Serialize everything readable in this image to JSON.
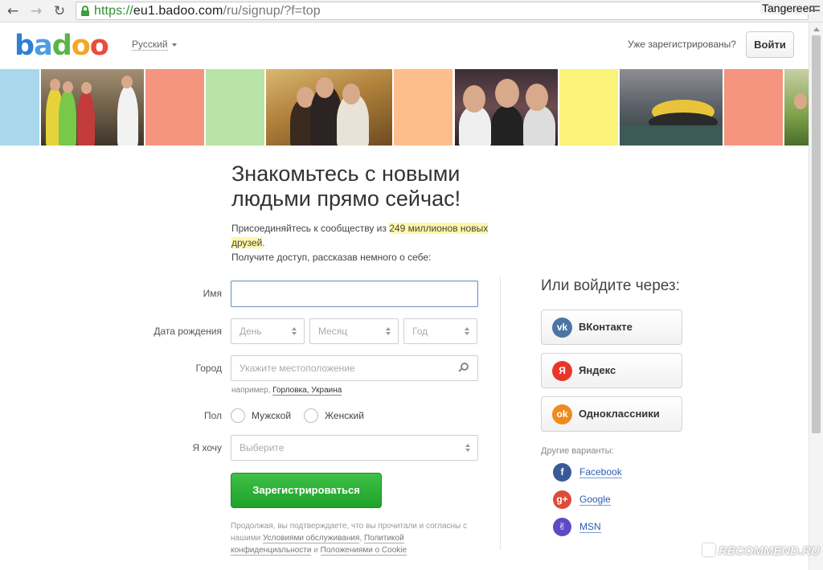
{
  "browser": {
    "url_scheme": "https://",
    "url_host": "eu1.badoo.com",
    "url_path": "/ru/signup/?f=top",
    "profile_name": "Tangereen"
  },
  "header": {
    "logo": [
      "b",
      "a",
      "d",
      "o",
      "o"
    ],
    "language": "Русский",
    "already_registered": "Уже зарегистрированы?",
    "login_label": "Войти"
  },
  "strip": {
    "colors": {
      "blue": "#a9d8ec",
      "coral": "#f5947f",
      "green": "#b8e4a8",
      "peach": "#fdbd8c",
      "yellow": "#fbf27a"
    }
  },
  "hero": {
    "title_line1": "Знакомьтесь с новыми",
    "title_line2": "людьми прямо сейчас!",
    "lead_pre": "Присоединяйтесь к сообществу из ",
    "lead_highlight": "249 миллионов новых друзей",
    "lead_post": ".",
    "lead_line3": "Получите доступ, рассказав немного о себе:"
  },
  "form": {
    "name_label": "Имя",
    "name_value": "",
    "birth_label": "Дата рождения",
    "day_placeholder": "День",
    "month_placeholder": "Месяц",
    "year_placeholder": "Год",
    "city_label": "Город",
    "city_placeholder": "Укажите местоположение",
    "example_prefix": "например, ",
    "example_link": "Горловка, Украина",
    "gender_label": "Пол",
    "male": "Мужской",
    "female": "Женский",
    "want_label": "Я хочу",
    "want_placeholder": "Выберите",
    "register_label": "Зарегистрироваться",
    "terms_text1": "Продолжая, вы подтверждаете, что вы прочитали и согласны с нашими ",
    "terms_link1": "Условиями обслуживания",
    "terms_sep": ", ",
    "terms_link2": "Политикой конфиденциальности",
    "terms_and": " и ",
    "terms_link3": "Положениями о Cookie"
  },
  "social": {
    "title": "Или войдите через:",
    "buttons": [
      {
        "label": "ВКонтакте",
        "glyph": "vk",
        "color": "#4c75a3"
      },
      {
        "label": "Яндекс",
        "glyph": "Я",
        "color": "#e8362c"
      },
      {
        "label": "Одноклассники",
        "glyph": "ok",
        "color": "#f08a1e"
      }
    ],
    "other_title": "Другие варианты:",
    "others": [
      {
        "label": "Facebook",
        "glyph": "f",
        "color": "#3b5998"
      },
      {
        "label": "Google",
        "glyph": "g+",
        "color": "#dd4b39"
      },
      {
        "label": "MSN",
        "glyph": "✌",
        "color": "#5b4bc4"
      }
    ]
  },
  "watermark": "RECOMMEND.RU"
}
